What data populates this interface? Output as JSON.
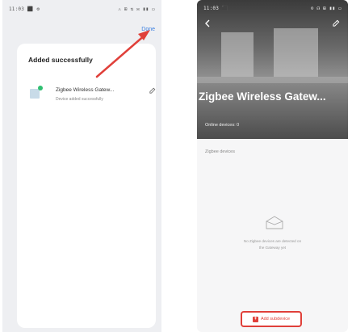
{
  "left_screen": {
    "status_time": "11:03 ⬛ ⚙",
    "status_icons": "⚠ ⊞ ⇅ ✉ ▮▮ ▭",
    "done_label": "Done",
    "title": "Added successfully",
    "device_name": "Zigbee Wireless Gatew...",
    "device_status": "Device added successfully"
  },
  "right_screen": {
    "status_time": "11:03 ⬛",
    "status_icons": "⊙ ☊ ⊞ ▮▮ ▭",
    "device_title": "Zigbee Wireless Gatew...",
    "device_status": "Online devices: 0",
    "section_title": "Zigbee devices",
    "empty_line1": "No Zigbee devices are detected on",
    "empty_line2": "the Gateway yet",
    "add_button_label": "Add subdevice"
  },
  "colors": {
    "link_blue": "#3b7fe0",
    "highlight_red": "#e0403a",
    "online_green": "#2fbf71"
  },
  "icons": [
    "edit-icon",
    "back-icon",
    "empty-box-icon",
    "add-icon",
    "gateway-device-icon"
  ]
}
